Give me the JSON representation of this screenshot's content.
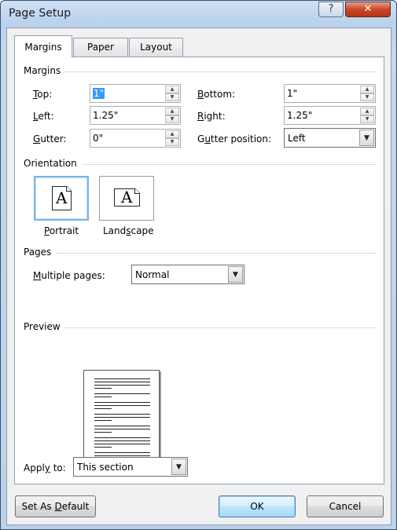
{
  "window": {
    "title": "Page Setup",
    "help_glyph": "?",
    "close_glyph": "✕"
  },
  "tabs": [
    {
      "label": "Margins",
      "active": true
    },
    {
      "label": "Paper",
      "active": false
    },
    {
      "label": "Layout",
      "active": false
    }
  ],
  "margins": {
    "group_label": "Margins",
    "top": {
      "label": "Top:",
      "value": "1\""
    },
    "bottom": {
      "label": "Bottom:",
      "value": "1\""
    },
    "left": {
      "label": "Left:",
      "value": "1.25\""
    },
    "right": {
      "label": "Right:",
      "value": "1.25\""
    },
    "gutter": {
      "label": "Gutter:",
      "value": "0\""
    },
    "gutter_position": {
      "label": "Gutter position:",
      "value": "Left"
    }
  },
  "orientation": {
    "group_label": "Orientation",
    "portrait": {
      "label": "Portrait",
      "glyph": "A",
      "selected": true
    },
    "landscape": {
      "label": "Landscape",
      "glyph": "A",
      "selected": false
    }
  },
  "pages": {
    "group_label": "Pages",
    "multiple_pages": {
      "label": "Multiple pages:",
      "value": "Normal"
    }
  },
  "preview": {
    "group_label": "Preview"
  },
  "apply_to": {
    "label": "Apply to:",
    "value": "This section"
  },
  "buttons": {
    "set_default": "Set As Default",
    "ok": "OK",
    "cancel": "Cancel"
  },
  "icons": {
    "spin_up": "▲",
    "spin_down": "▼",
    "dropdown": "▼"
  }
}
